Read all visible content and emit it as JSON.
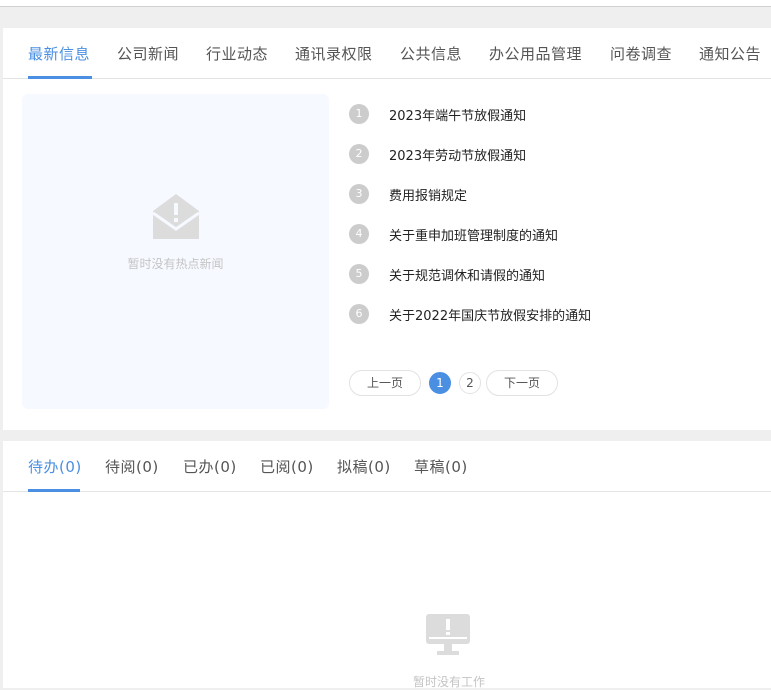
{
  "news_tabs": [
    "最新信息",
    "公司新闻",
    "行业动态",
    "通讯录权限",
    "公共信息",
    "办公用品管理",
    "问卷调查",
    "通知公告"
  ],
  "hot_news_empty": "暂时没有热点新闻",
  "news_list": [
    {
      "num": "1",
      "title": "2023年端午节放假通知"
    },
    {
      "num": "2",
      "title": "2023年劳动节放假通知"
    },
    {
      "num": "3",
      "title": "费用报销规定"
    },
    {
      "num": "4",
      "title": "关于重申加班管理制度的通知"
    },
    {
      "num": "5",
      "title": "关于规范调休和请假的通知"
    },
    {
      "num": "6",
      "title": "关于2022年国庆节放假安排的通知"
    }
  ],
  "pagination": {
    "prev": "上一页",
    "pages": [
      "1",
      "2"
    ],
    "current": "1",
    "next": "下一页"
  },
  "work_tabs": [
    "待办(0)",
    "待阅(0)",
    "已办(0)",
    "已阅(0)",
    "拟稿(0)",
    "草稿(0)"
  ],
  "work_empty": "暂时没有工作",
  "colors": {
    "accent": "#4a8fe2",
    "empty_panel": "#f6f9ff"
  }
}
